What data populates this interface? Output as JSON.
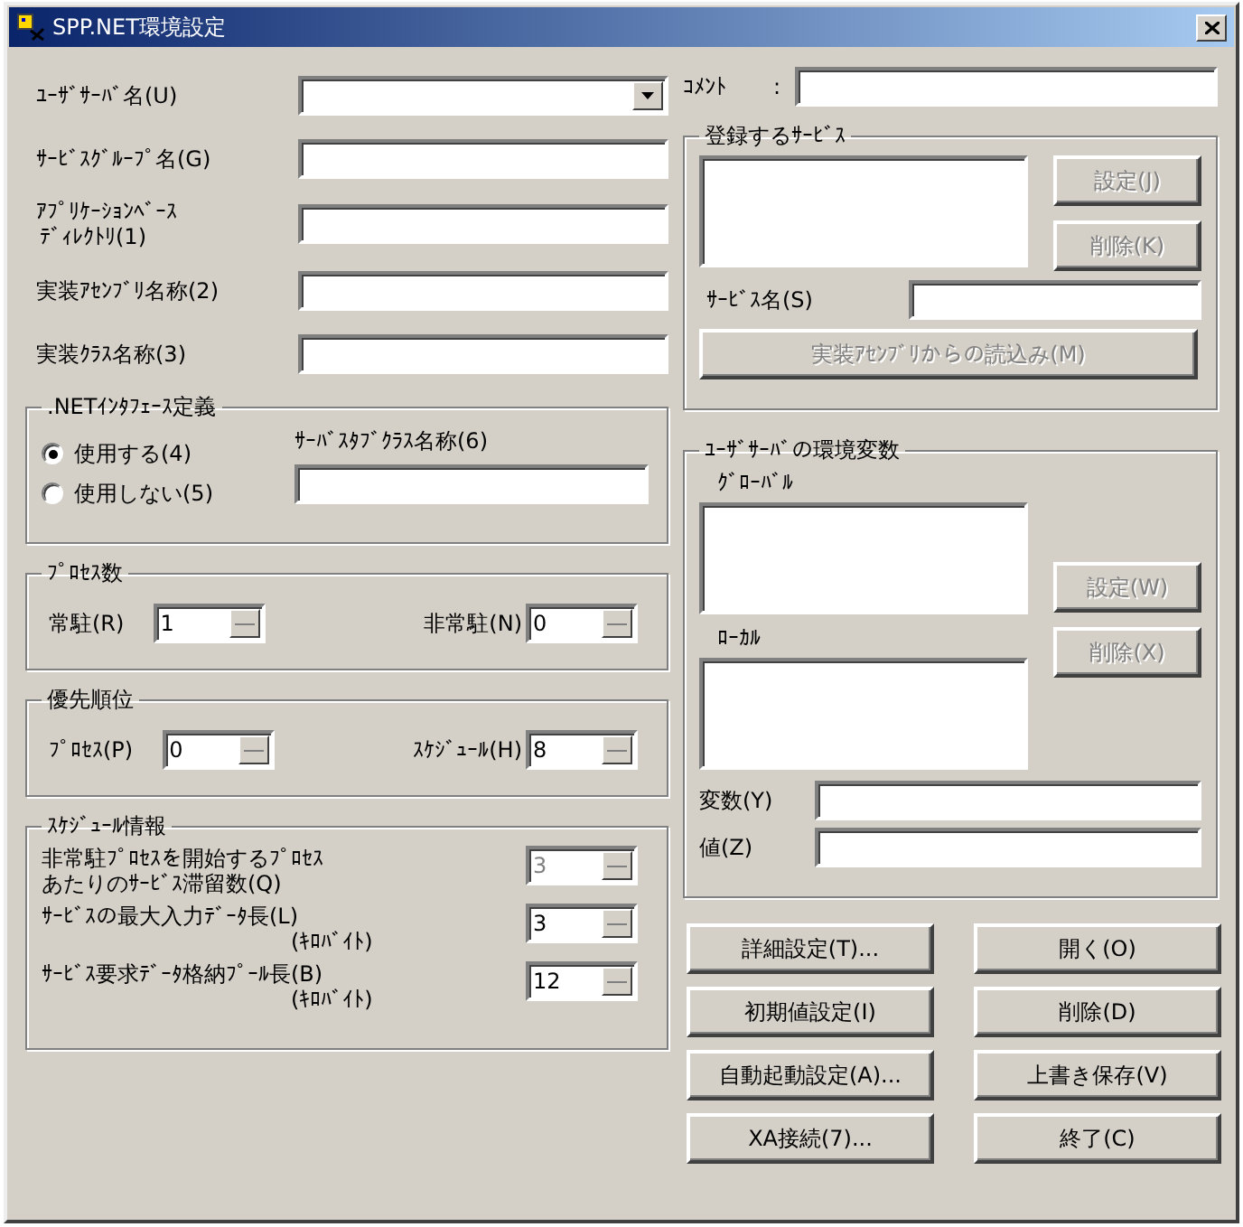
{
  "window": {
    "title": "SPP.NET環境設定"
  },
  "left_fields": [
    {
      "kind": "combo",
      "label": [
        "ﾕｰｻﾞｻｰﾊﾞ名(U)"
      ]
    },
    {
      "kind": "text",
      "label": [
        "ｻｰﾋﾞｽｸﾞﾙｰﾌﾟ名(G)"
      ]
    },
    {
      "kind": "text",
      "label": [
        "ｱﾌﾟﾘｹｰｼｮﾝﾍﾞｰｽ",
        "ﾃﾞｨﾚｸﾄﾘ(1)"
      ]
    },
    {
      "kind": "text",
      "label": [
        "実装ｱｾﾝﾌﾞﾘ名称(2)"
      ]
    },
    {
      "kind": "text",
      "label": [
        "実装ｸﾗｽ名称(3)"
      ]
    }
  ],
  "net_interface": {
    "title": ".NETｲﾝﾀﾌｪｰｽ定義",
    "options": [
      {
        "label": "使用する(4)",
        "selected": true
      },
      {
        "label": "使用しない(5)",
        "selected": false
      }
    ],
    "stub_label": "ｻｰﾊﾞｽﾀﾌﾞｸﾗｽ名称(6)"
  },
  "process_count": {
    "title": "ﾌﾟﾛｾｽ数",
    "spinners": [
      {
        "label": "常駐(R)",
        "value": "1"
      },
      {
        "label": "非常駐(N)",
        "value": "0"
      }
    ]
  },
  "priority": {
    "title": "優先順位",
    "spinners": [
      {
        "label": "ﾌﾟﾛｾｽ(P)",
        "value": "0"
      },
      {
        "label": "ｽｹｼﾞｭｰﾙ(H)",
        "value": "8"
      }
    ]
  },
  "schedule": {
    "title": "ｽｹｼﾞｭｰﾙ情報",
    "rows": [
      {
        "label": [
          "非常駐ﾌﾟﾛｾｽを開始するﾌﾟﾛｾｽ",
          "あたりのｻｰﾋﾞｽ滞留数(Q)"
        ],
        "value": "3",
        "disabled": true
      },
      {
        "label": [
          "ｻｰﾋﾞｽの最大入力ﾃﾞｰﾀ長(L)"
        ],
        "unit": "(ｷﾛﾊﾞｲﾄ)",
        "value": "3",
        "disabled": false
      },
      {
        "label": [
          "ｻｰﾋﾞｽ要求ﾃﾞｰﾀ格納ﾌﾟｰﾙ長(B)"
        ],
        "unit": "(ｷﾛﾊﾞｲﾄ)",
        "value": "12",
        "disabled": false
      }
    ]
  },
  "comment": {
    "label": "ｺﾒﾝﾄ",
    "separator": ":"
  },
  "services": {
    "title": "登録するｻｰﾋﾞｽ",
    "buttons": [
      {
        "label": "設定(J)",
        "disabled": true
      },
      {
        "label": "削除(K)",
        "disabled": true
      }
    ],
    "name_label": "ｻｰﾋﾞｽ名(S)",
    "load_button": {
      "label": "実装ｱｾﾝﾌﾞﾘからの読込み(M)",
      "disabled": true
    }
  },
  "env": {
    "title": "ﾕｰｻﾞｻｰﾊﾞの環境変数",
    "global_label": "ｸﾞﾛｰﾊﾞﾙ",
    "local_label": "ﾛｰｶﾙ",
    "buttons": [
      {
        "label": "設定(W)",
        "disabled": true
      },
      {
        "label": "削除(X)",
        "disabled": true
      }
    ],
    "fields": [
      {
        "label": "変数(Y)"
      },
      {
        "label": "値(Z)"
      }
    ]
  },
  "actions": [
    {
      "label": "詳細設定(T)...",
      "disabled": false
    },
    {
      "label": "開く(O)",
      "disabled": false
    },
    {
      "label": "初期値設定(I)",
      "disabled": false
    },
    {
      "label": "削除(D)",
      "disabled": false
    },
    {
      "label": "自動起動設定(A)...",
      "disabled": false
    },
    {
      "label": "上書き保存(V)",
      "disabled": false
    },
    {
      "label": "XA接続(7)...",
      "disabled": false
    },
    {
      "label": "終了(C)",
      "disabled": false
    }
  ]
}
